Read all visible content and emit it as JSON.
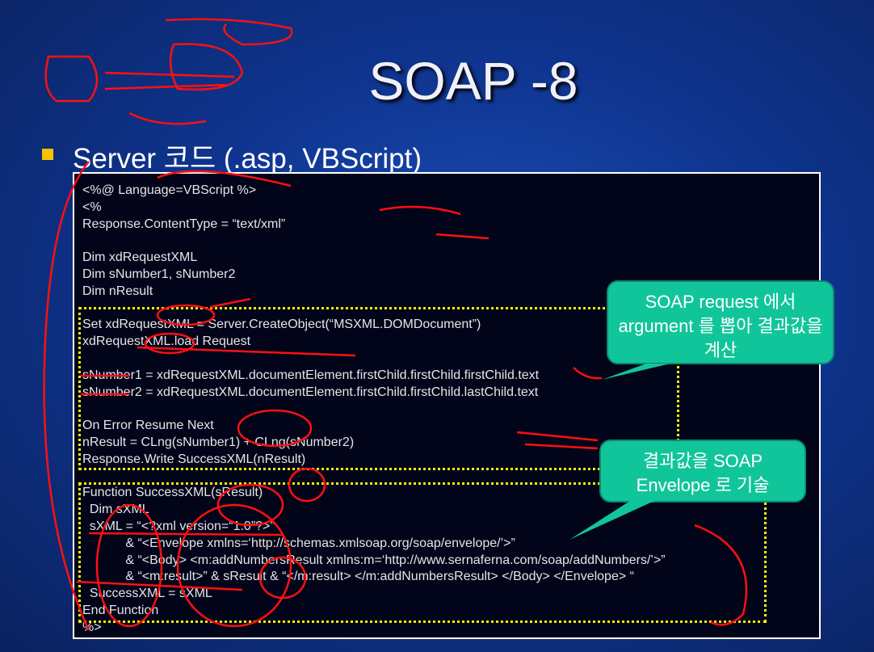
{
  "title": "SOAP -8",
  "subtitle": "Server 코드 (.asp, VBScript)",
  "code_lines": [
    "<%@ Language=VBScript %>",
    "<%",
    "Response.ContentType = “text/xml”",
    "",
    "Dim xdRequestXML",
    "Dim sNumber1, sNumber2",
    "Dim nResult",
    "",
    "Set xdRequestXML = Server.CreateObject(“MSXML.DOMDocument”)",
    "xdRequestXML.load Request",
    "",
    "sNumber1 = xdRequestXML.documentElement.firstChild.firstChild.firstChild.text",
    "sNumber2 = xdRequestXML.documentElement.firstChild.firstChild.lastChild.text",
    "",
    "On Error Resume Next",
    "nResult = CLng(sNumber1) + CLng(sNumber2)",
    "Response.Write SuccessXML(nResult)",
    "",
    "Function SuccessXML(sResult)",
    "  Dim sXML",
    "  sXML = “<?xml version=“1.0”?>”",
    "            & “<Envelope xmlns=‘http://schemas.xmlsoap.org/soap/envelope/’>”",
    "            & “<Body> <m:addNumbersResult xmlns:m=‘http://www.sernaferna.com/soap/addNumbers/’>”",
    "            & “<m:result>” & sResult & “</m:result> </m:addNumbersResult> </Body> </Envelope> “",
    "  SuccessXML = sXML",
    "End Function",
    "%>"
  ],
  "callouts": {
    "request": "SOAP request 에서 argument 를 뽑아 결과값을 계산",
    "envelope": "결과값을 SOAP Envelope 로 기술"
  },
  "colors": {
    "callout": "#11c59a",
    "highlight": "#f2f200",
    "ink": "#ff1010"
  }
}
